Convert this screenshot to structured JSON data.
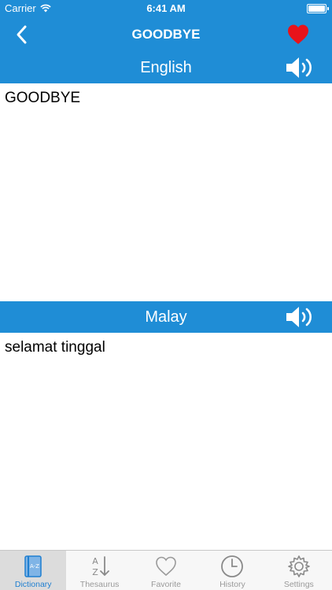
{
  "status_bar": {
    "carrier": "Carrier",
    "time": "6:41 AM"
  },
  "nav": {
    "title": "GOODBYE",
    "back_icon": "chevron-left-icon",
    "favorite_icon": "heart-icon",
    "favorite_color": "#e8131b"
  },
  "source": {
    "language": "English",
    "text": "GOODBYE"
  },
  "target": {
    "language": "Malay",
    "text": "selamat tinggal"
  },
  "tabs": [
    {
      "label": "Dictionary",
      "icon": "dictionary-icon",
      "active": true
    },
    {
      "label": "Thesaurus",
      "icon": "sort-az-icon",
      "active": false
    },
    {
      "label": "Favorite",
      "icon": "heart-outline-icon",
      "active": false
    },
    {
      "label": "History",
      "icon": "clock-icon",
      "active": false
    },
    {
      "label": "Settings",
      "icon": "gear-icon",
      "active": false
    }
  ],
  "colors": {
    "accent": "#1f8dd6",
    "tab_active": "#1f7fd0",
    "tab_inactive": "#9a9a9a"
  }
}
